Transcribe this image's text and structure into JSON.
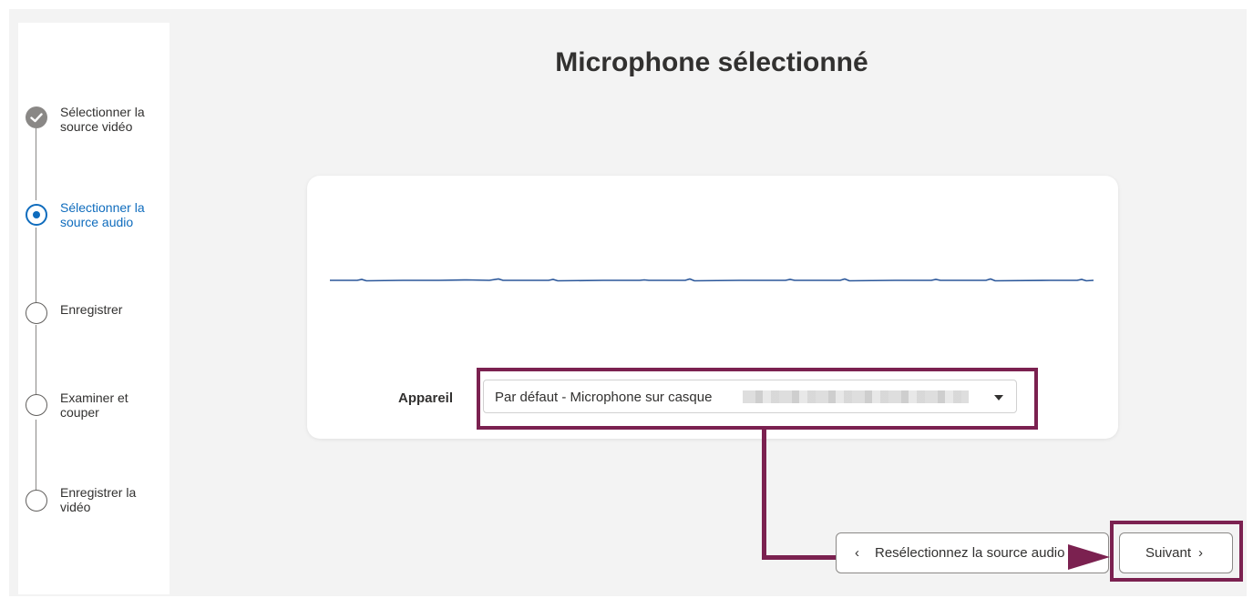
{
  "page": {
    "title": "Microphone sélectionné"
  },
  "steps": [
    {
      "label": "Sélectionner la source vidéo",
      "state": "done"
    },
    {
      "label": "Sélectionner la source audio",
      "state": "active"
    },
    {
      "label": "Enregistrer",
      "state": "todo"
    },
    {
      "label": "Examiner et couper",
      "state": "todo"
    },
    {
      "label": "Enregistrer la vidéo",
      "state": "todo"
    }
  ],
  "device": {
    "label": "Appareil",
    "selected_value": "Par défaut - Microphone sur casque"
  },
  "buttons": {
    "back_label": "Resélectionnez la source audio",
    "next_label": "Suivant"
  },
  "icons": {
    "step_done": "checkmark-icon",
    "dropdown": "caret-down-icon",
    "back": "chevron-left-icon",
    "next": "chevron-right-icon"
  },
  "colors": {
    "accent": "#0f6cbd",
    "highlight": "#7b2150",
    "waveform": "#2b579a"
  }
}
